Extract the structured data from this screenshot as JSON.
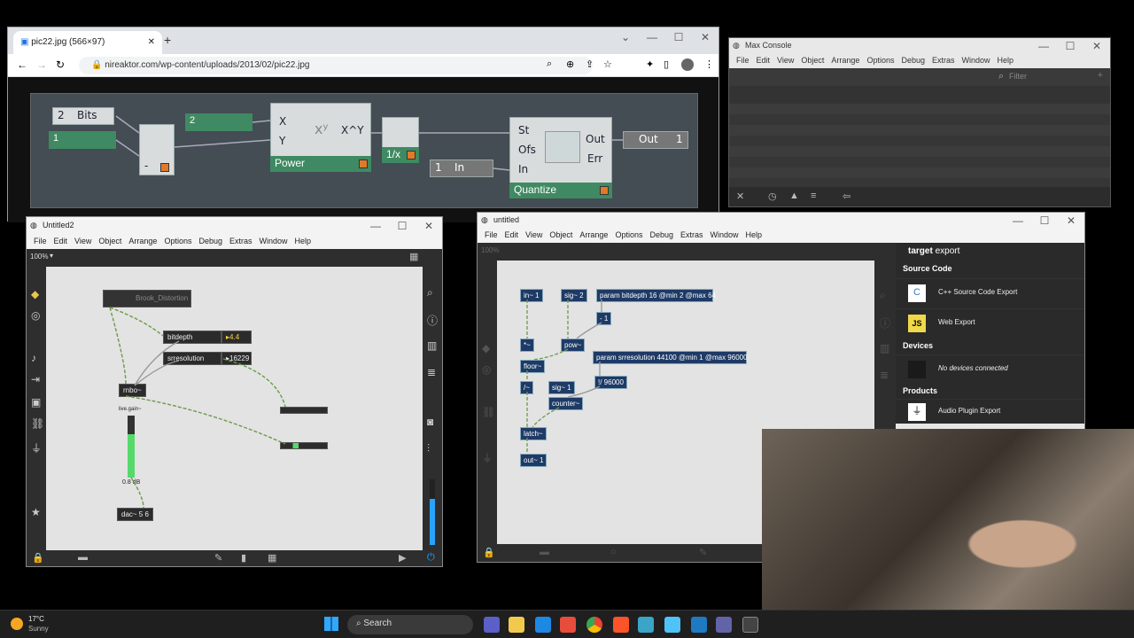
{
  "browser": {
    "tab_title": "pic22.jpg (566×97)",
    "url": "nireaktor.com/wp-content/uploads/2013/02/pic22.jpg",
    "reaktor": {
      "bits_value": "2",
      "bits_label": "Bits",
      "one_value": "1",
      "two_value": "2",
      "power_label": "Power",
      "x_label": "X",
      "y_label": "Y",
      "xy_label": "X^Y",
      "xy_sym": "xʸ",
      "minus_label": "-",
      "recip_label": "1/x",
      "in_value": "1",
      "in_label": "In",
      "st": "St",
      "ofs": "Ofs",
      "in": "In",
      "out": "Out",
      "err": "Err",
      "quantize_label": "Quantize",
      "out_label": "Out",
      "out_value": "1"
    }
  },
  "console": {
    "title": "Max Console",
    "menu": [
      "File",
      "Edit",
      "View",
      "Object",
      "Arrange",
      "Options",
      "Debug",
      "Extras",
      "Window",
      "Help"
    ],
    "filter_placeholder": "Filter"
  },
  "untitled2": {
    "title": "Untitled2",
    "menu": [
      "File",
      "Edit",
      "View",
      "Object",
      "Arrange",
      "Options",
      "Debug",
      "Extras",
      "Window",
      "Help"
    ],
    "zoom": "100%",
    "objects": {
      "brook": "Brook_Distortion",
      "bitdepth": "bitdepth",
      "bitdepth_value": "4.4",
      "srresolution": "srresolution",
      "srresolution_value": "16229",
      "rnbo": "rnbo~",
      "livegain": "live.gain~",
      "gain_db": "0.8 dB",
      "dac": "dac~ 5 6"
    }
  },
  "untitled": {
    "title": "untitled",
    "menu": [
      "File",
      "Edit",
      "View",
      "Object",
      "Arrange",
      "Options",
      "Debug",
      "Extras",
      "Window",
      "Help"
    ],
    "zoom": "100%",
    "objects": {
      "in1": "in~ 1",
      "sig2": "sig~ 2",
      "param_bitdepth": "param bitdepth 16 @min 2 @max 64",
      "minus1": "- 1",
      "mult": "*~",
      "pow": "pow~",
      "param_sr": "param srresolution 44100 @min 1 @max 96000",
      "floor": "floor~",
      "div": "/~",
      "sig1": "sig~ 1",
      "rdiv": "!/ 96000",
      "counter": "counter~",
      "latch": "latch~",
      "out1": "out~ 1"
    },
    "export": {
      "target_label": "target",
      "target_value": "export",
      "source_code": "Source Code",
      "cpp": "C++ Source Code Export",
      "web": "Web Export",
      "devices": "Devices",
      "no_devices": "No devices connected",
      "products": "Products",
      "audio_plugin": "Audio Plugin Export"
    }
  },
  "taskbar": {
    "weather_temp": "17°C",
    "weather_desc": "Sunny",
    "search_label": "Search"
  }
}
